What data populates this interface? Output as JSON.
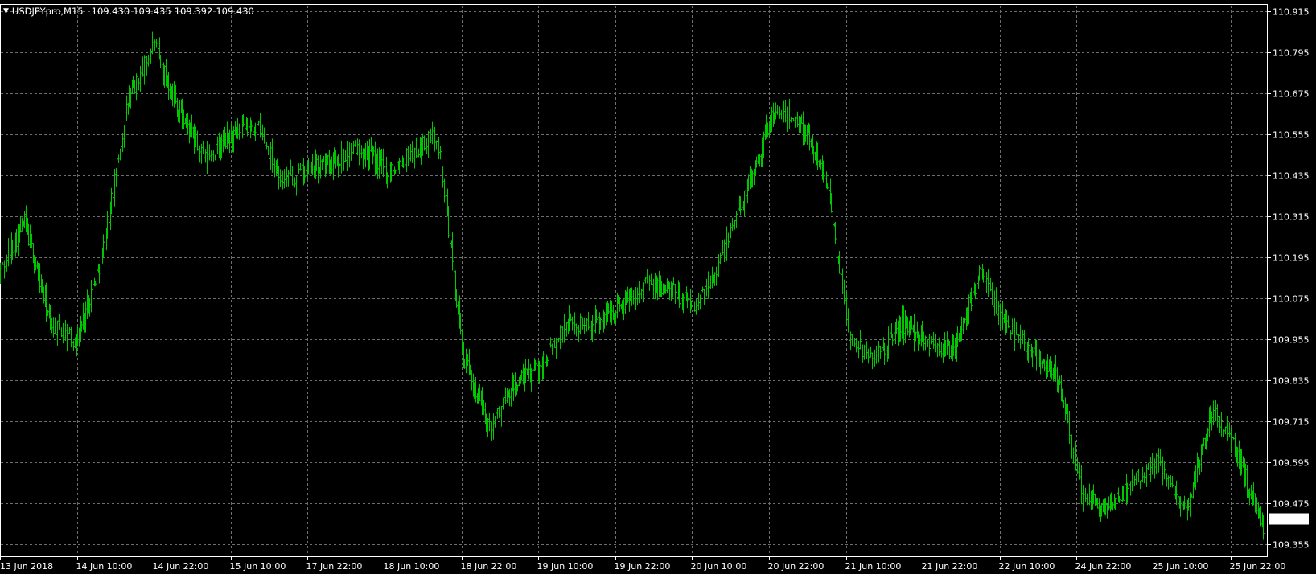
{
  "window": {
    "symbol": "USDJPYpro",
    "timeframe": "M15",
    "header_text": "USDJPYpro,M15",
    "ohlc": [
      "109.430",
      "109.435",
      "109.392",
      "109.430"
    ]
  },
  "colors": {
    "background": "#000000",
    "grid": "#6e6e6e",
    "bars": "#00c800",
    "axis": "#ffffff",
    "text": "#ffffff",
    "price_line": "#c0c0c0"
  },
  "chart_data": {
    "type": "line",
    "title": "",
    "xlabel": "",
    "ylabel": "",
    "ylim": [
      109.32,
      110.935
    ],
    "grid": true,
    "legend": "none",
    "yticks": [
      "110.915",
      "110.795",
      "110.675",
      "110.555",
      "110.435",
      "110.315",
      "110.195",
      "110.075",
      "109.955",
      "109.835",
      "109.715",
      "109.595",
      "109.475",
      "109.355"
    ],
    "xticks": [
      "13 Jun 2018",
      "14 Jun 10:00",
      "14 Jun 22:00",
      "15 Jun 10:00",
      "17 Jun 22:00",
      "18 Jun 10:00",
      "18 Jun 22:00",
      "19 Jun 10:00",
      "19 Jun 22:00",
      "20 Jun 10:00",
      "20 Jun 22:00",
      "21 Jun 10:00",
      "21 Jun 22:00",
      "22 Jun 10:00",
      "24 Jun 22:00",
      "25 Jun 10:00",
      "25 Jun 22:00"
    ],
    "current_price": "109.430",
    "series": [
      {
        "x": [
          "13 Jun 2018",
          "13 Jun 2018 +",
          "14 Jun 10:00 -",
          "14 Jun 10:00",
          "14 Jun 10:00 +",
          "14 Jun 22:00 -",
          "14 Jun 22:00",
          "14 Jun 22:00 +",
          "15 Jun 10:00 -",
          "15 Jun 10:00",
          "15 Jun 10:00 +",
          "17 Jun 22:00 -",
          "17 Jun 22:00",
          "17 Jun 22:00 +",
          "18 Jun 10:00 -",
          "18 Jun 10:00",
          "18 Jun 10:00 +",
          "18 Jun 22:00 -",
          "18 Jun 22:00",
          "18 Jun 22:00 +",
          "19 Jun 10:00 -",
          "19 Jun 10:00",
          "19 Jun 10:00 +",
          "19 Jun 22:00 -",
          "19 Jun 22:00",
          "19 Jun 22:00 +",
          "20 Jun 10:00 -",
          "20 Jun 10:00",
          "20 Jun 10:00 +",
          "20 Jun 22:00 -",
          "20 Jun 22:00",
          "20 Jun 22:00 +",
          "21 Jun 10:00 -",
          "21 Jun 10:00",
          "21 Jun 10:00 +",
          "21 Jun 22:00 -",
          "21 Jun 22:00",
          "21 Jun 22:00 +",
          "22 Jun 10:00 -",
          "22 Jun 10:00",
          "22 Jun 10:00 +",
          "24 Jun 22:00 -",
          "24 Jun 22:00",
          "24 Jun 22:00 +",
          "25 Jun 10:00 -",
          "25 Jun 10:00",
          "25 Jun 10:00 +",
          "25 Jun 22:00 -",
          "25 Jun 22:00",
          "end"
        ],
        "y": [
          110.15,
          110.3,
          110.0,
          109.95,
          110.2,
          110.65,
          110.82,
          110.62,
          110.48,
          110.55,
          110.58,
          110.42,
          110.45,
          110.48,
          110.52,
          110.45,
          110.5,
          110.56,
          109.9,
          109.7,
          109.82,
          109.88,
          110.0,
          110.0,
          110.05,
          110.12,
          110.1,
          110.05,
          110.2,
          110.4,
          110.62,
          110.6,
          110.45,
          109.95,
          109.9,
          110.0,
          109.95,
          109.92,
          110.15,
          110.0,
          109.93,
          109.85,
          109.5,
          109.45,
          109.55,
          109.6,
          109.45,
          109.75,
          109.62,
          109.4
        ]
      }
    ]
  }
}
